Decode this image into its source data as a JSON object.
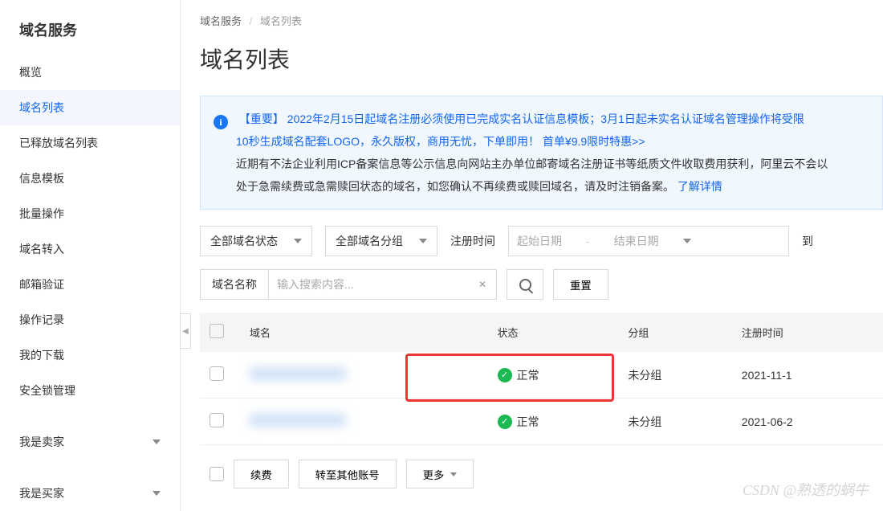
{
  "sidebar": {
    "title": "域名服务",
    "items": [
      {
        "label": "概览"
      },
      {
        "label": "域名列表",
        "active": true
      },
      {
        "label": "已释放域名列表"
      },
      {
        "label": "信息模板"
      },
      {
        "label": "批量操作"
      },
      {
        "label": "域名转入"
      },
      {
        "label": "邮箱验证"
      },
      {
        "label": "操作记录"
      },
      {
        "label": "我的下载"
      },
      {
        "label": "安全锁管理"
      }
    ],
    "group_seller": "我是卖家",
    "group_buyer": "我是买家"
  },
  "breadcrumb": {
    "root": "域名服务",
    "current": "域名列表"
  },
  "page_title": "域名列表",
  "notice": {
    "important_tag": "【重要】",
    "line1_part1": "2022年2月15日起域名注册必须使用已完成实名认证信息模板；3月1日起未实名认证域名管理操作将受限",
    "line2_part1": "10秒生成域名配套LOGO，永久版权，商用无忧，下单即用！",
    "line2_link": "首单¥9.9限时特惠>>",
    "line3": "近期有不法企业利用ICP备案信息等公示信息向网站主办单位邮寄域名注册证书等纸质文件收取费用获利，阿里云不会以",
    "line4_part1": "处于急需续费或急需赎回状态的域名，如您确认不再续费或赎回域名，请及时注销备案。",
    "line4_link": "了解详情"
  },
  "filters": {
    "status_label": "全部域名状态",
    "group_label": "全部域名分组",
    "reg_time_label": "注册时间",
    "start_date_placeholder": "起始日期",
    "end_date_placeholder": "结束日期",
    "end_col_label": "到",
    "search_type": "域名名称",
    "search_placeholder": "输入搜索内容...",
    "reset_label": "重置"
  },
  "table": {
    "headers": {
      "domain": "域名",
      "status": "状态",
      "group": "分组",
      "reg_time": "注册时间"
    },
    "rows": [
      {
        "status": "正常",
        "group": "未分组",
        "reg_time": "2021-11-1"
      },
      {
        "status": "正常",
        "group": "未分组",
        "reg_time": "2021-06-2"
      }
    ]
  },
  "batch": {
    "renew": "续费",
    "transfer": "转至其他账号",
    "more": "更多"
  },
  "watermark": "CSDN @熟透的蜗牛"
}
